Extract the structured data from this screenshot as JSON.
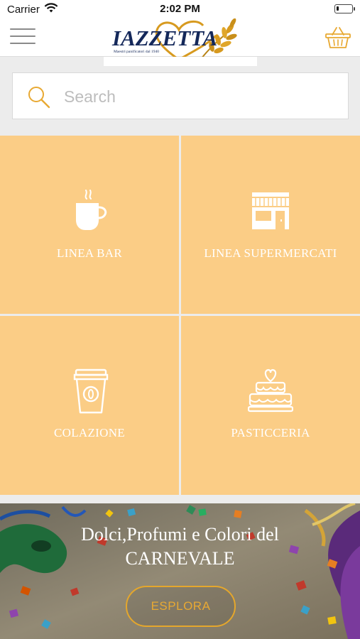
{
  "status_bar": {
    "carrier": "Carrier",
    "time": "2:02 PM",
    "wifi_icon": "wifi-icon",
    "battery_icon": "battery-icon",
    "battery_level": 0.15
  },
  "header": {
    "menu_icon": "hamburger-menu-icon",
    "logo": {
      "text": "IAZZETTA",
      "tagline": "Maestri panificatori dal 1940"
    },
    "cart_icon": "shopping-basket-icon"
  },
  "search": {
    "placeholder": "Search",
    "value": "",
    "icon": "search-icon"
  },
  "categories": [
    {
      "label": "LINEA BAR",
      "icon": "coffee-cup-icon"
    },
    {
      "label": "LINEA SUPERMERCATI",
      "icon": "store-icon"
    },
    {
      "label": "COLAZIONE",
      "icon": "takeaway-cup-icon"
    },
    {
      "label": "PASTICCERIA",
      "icon": "cake-icon"
    }
  ],
  "banner": {
    "title_line1": "Dolci,Profumi e Colori del",
    "title_line2": "CARNEVALE",
    "button_label": "ESPLORA"
  },
  "colors": {
    "tile": "#fbcd86",
    "accent": "#e8a933",
    "brand_navy": "#14285a",
    "brand_gold": "#d79a1f"
  }
}
